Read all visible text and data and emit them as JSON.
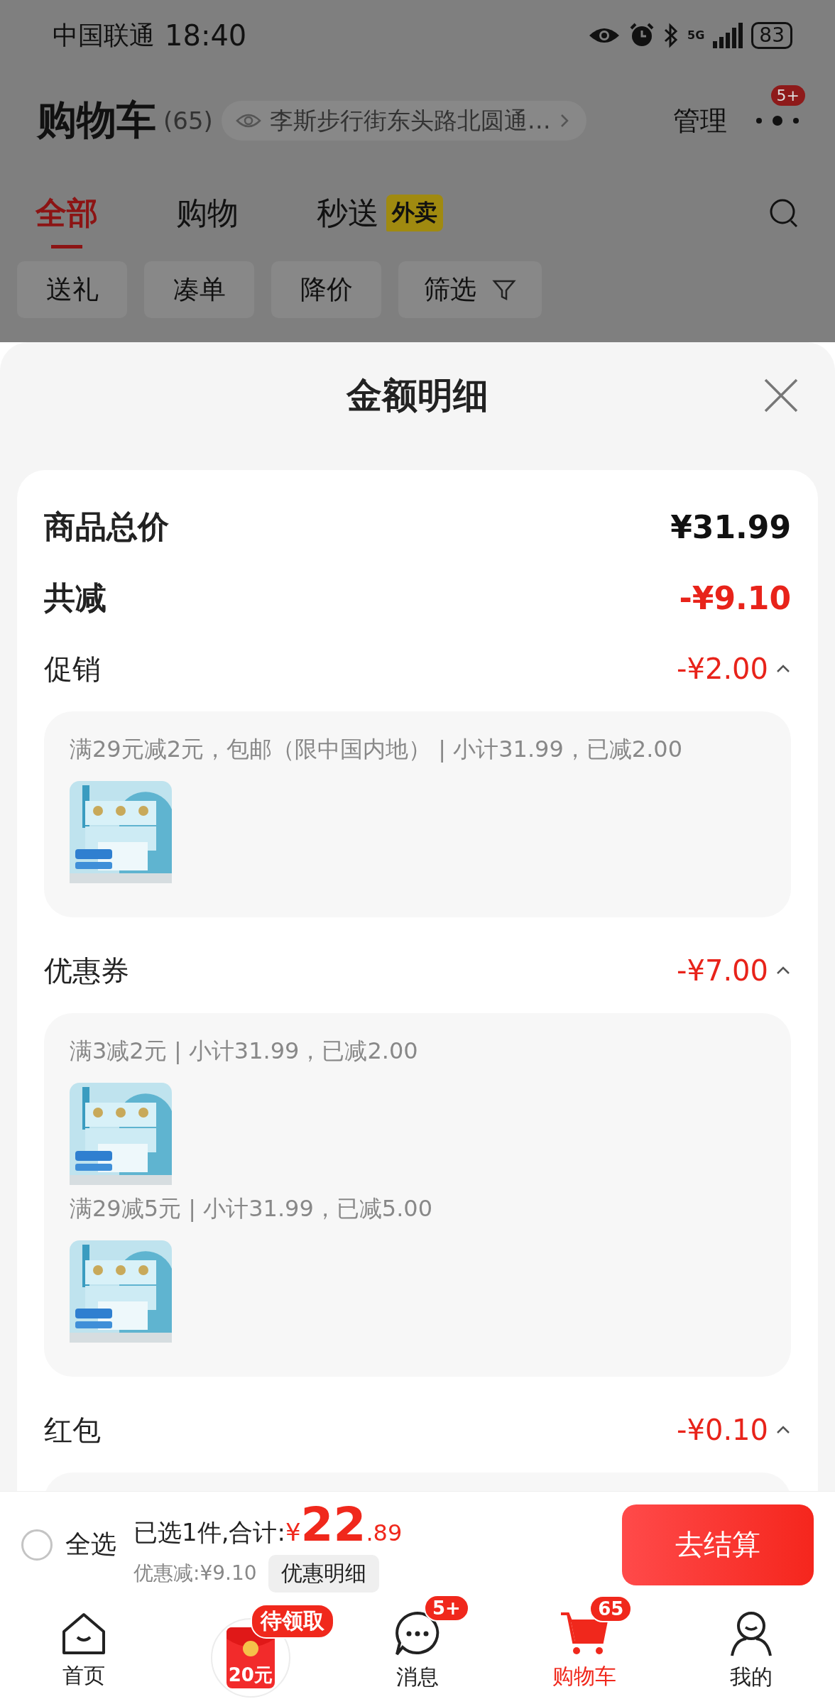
{
  "status_bar": {
    "carrier": "中国联通",
    "time": "18:40",
    "network": "5G",
    "battery": "83"
  },
  "header": {
    "title": "购物车",
    "count": "(65)",
    "address": "李斯步行街东头路北圆通…",
    "manage": "管理",
    "more_badge": "5+"
  },
  "tabs": [
    {
      "label": "全部",
      "selected": true
    },
    {
      "label": "购物",
      "selected": false
    },
    {
      "label": "秒送",
      "tag": "外卖",
      "selected": false
    }
  ],
  "filters": [
    {
      "label": "送礼",
      "kind": "plain"
    },
    {
      "label": "凑单",
      "kind": "plain"
    },
    {
      "label": "降价",
      "kind": "plain"
    },
    {
      "label": "筛选",
      "kind": "filter"
    }
  ],
  "sheet": {
    "title": "金额明细",
    "totals": [
      {
        "label": "商品总价",
        "value": "¥31.99",
        "kind": "total"
      },
      {
        "label": "共减",
        "value": "-¥9.10",
        "kind": "discount"
      }
    ],
    "sections": [
      {
        "label": "促销",
        "value": "-¥2.00",
        "expanded": true,
        "groups": [
          {
            "text": "满29元减2元，包邮（限中国内地） | 小计31.99，已减2.00"
          }
        ]
      },
      {
        "label": "优惠券",
        "value": "-¥7.00",
        "expanded": true,
        "groups": [
          {
            "text": "满3减2元 | 小计31.99，已减2.00"
          },
          {
            "text": "满29减5元 | 小计31.99，已减5.00"
          }
        ]
      },
      {
        "label": "红包",
        "value": "-¥0.10",
        "expanded": true
      }
    ]
  },
  "footer": {
    "select_all": {
      "label": "全选",
      "checked": false
    },
    "summary": "已选1件,合计:",
    "currency": "¥",
    "price_int": "22",
    "price_dec": ".89",
    "saved": "优惠减:¥9.10",
    "detail_button": "优惠明细",
    "checkout": "去结算"
  },
  "nav": [
    {
      "label": "首页",
      "kind": "home",
      "selected": false
    },
    {
      "kind": "coupon",
      "badge": "待领取",
      "amount": "20元",
      "selected": false
    },
    {
      "label": "消息",
      "kind": "message",
      "badge": "5+",
      "selected": false
    },
    {
      "label": "购物车",
      "kind": "cart",
      "badge": "65",
      "selected": true
    },
    {
      "label": "我的",
      "kind": "profile",
      "selected": false
    }
  ]
}
